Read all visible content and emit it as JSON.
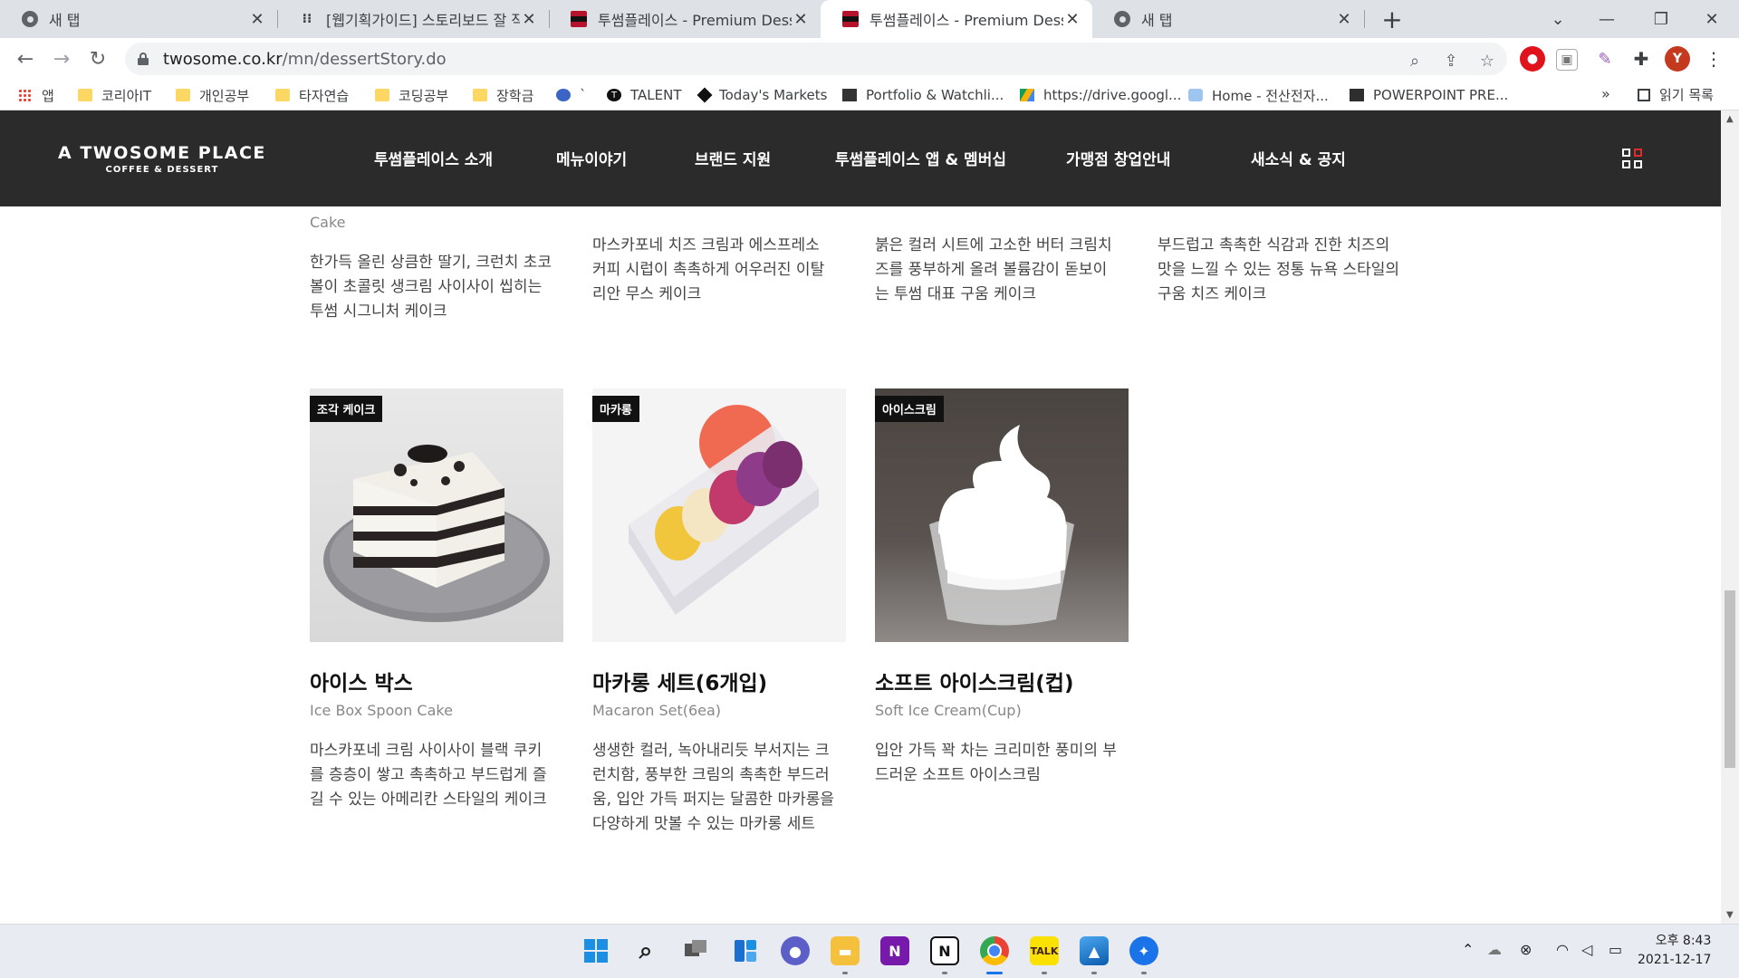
{
  "browser": {
    "tabs": [
      {
        "title": "새 탭",
        "icon": "chrome-icon",
        "active": false
      },
      {
        "title": "[웹기획가이드] 스토리보드 잘 작",
        "icon": "dots-icon",
        "active": false
      },
      {
        "title": "투썸플레이스 - Premium Desser",
        "icon": "twosome-icon",
        "active": false
      },
      {
        "title": "투썸플레이스 - Premium Desser",
        "icon": "twosome-icon",
        "active": true
      },
      {
        "title": "새 탭",
        "icon": "chrome-icon",
        "active": false
      }
    ],
    "new_tab": "+",
    "url_host": "twosome.co.kr",
    "url_path": "/mn/dessertStory.do",
    "profile_initial": "Y",
    "bookmarks": [
      {
        "label": "앱",
        "icon": "apps-grid-icon"
      },
      {
        "label": "코리아IT",
        "icon": "folder-icon"
      },
      {
        "label": "개인공부",
        "icon": "folder-icon"
      },
      {
        "label": "타자연습",
        "icon": "folder-icon"
      },
      {
        "label": "코딩공부",
        "icon": "folder-icon"
      },
      {
        "label": "장학금",
        "icon": "folder-icon"
      },
      {
        "label": "`",
        "icon": "globe-icon"
      },
      {
        "label": "TALENT",
        "icon": "talent-icon"
      },
      {
        "label": "Today's Markets",
        "icon": "markets-icon"
      },
      {
        "label": "Portfolio & Watchli...",
        "icon": "investing-icon"
      },
      {
        "label": "https://drive.googl...",
        "icon": "drive-icon"
      },
      {
        "label": "Home - 전산전자...",
        "icon": "home-site-icon"
      },
      {
        "label": "POWERPOINT PRE...",
        "icon": "hcc-icon"
      }
    ],
    "bookmarks_overflow": "»",
    "reading_list": "읽기 목록"
  },
  "site": {
    "logo_main": "A TWOSOME PLACE",
    "logo_sub": "COFFEE & DESSERT",
    "nav": [
      "투썸플레이스 소개",
      "메뉴이야기",
      "브랜드 지원",
      "투썸플레이스 앱 & 멤버십",
      "가맹점 창업안내",
      "새소식 & 공지"
    ]
  },
  "top_row": [
    {
      "name_en_tail": "Cake",
      "desc": [
        "한가득 올린 상큼한 딸기, 크런치 초코",
        "볼이 초콜릿 생크림 사이사이 씹히는",
        "투썸 시그니처 케이크"
      ]
    },
    {
      "desc": [
        "마스카포네 치즈 크림과 에스프레소",
        "커피 시럽이 촉촉하게 어우러진 이탈",
        "리안 무스 케이크"
      ]
    },
    {
      "desc": [
        "붉은 컬러 시트에 고소한 버터 크림치",
        "즈를 풍부하게 올려 볼륨감이 돋보이",
        "는 투썸 대표 구움 케이크"
      ]
    },
    {
      "desc": [
        "부드럽고 촉촉한 식감과 진한 치즈의",
        "맛을 느낄 수 있는 정통 뉴욕 스타일의",
        "구움 치즈 케이크"
      ]
    }
  ],
  "products": [
    {
      "badge": "조각 케이크",
      "name": "아이스 박스",
      "name_en": "Ice Box Spoon Cake",
      "desc": [
        "마스카포네 크림 사이사이 블랙 쿠키",
        "를 층층이 쌓고 촉촉하고 부드럽게 즐",
        "길 수 있는 아메리칸 스타일의 케이크"
      ]
    },
    {
      "badge": "마카롱",
      "name": "마카롱 세트(6개입)",
      "name_en": "Macaron Set(6ea)",
      "desc": [
        "생생한 컬러, 녹아내리듯 부서지는 크",
        "런치함, 풍부한 크림의 촉촉한 부드러",
        "움, 입안 가득 퍼지는 달콤한 마카롱을",
        "다양하게 맛볼 수 있는 마카롱 세트"
      ]
    },
    {
      "badge": "아이스크림",
      "name": "소프트 아이스크림(컵)",
      "name_en": "Soft Ice Cream(Cup)",
      "desc": [
        "입안 가득 꽉 차는 크리미한 풍미의 부",
        "드러운 소프트 아이스크림"
      ]
    }
  ],
  "taskbar": {
    "apps": [
      "windows-start-icon",
      "search-icon",
      "task-view-icon",
      "widgets-icon",
      "chat-icon",
      "file-explorer-icon",
      "onenote-icon",
      "notion-icon",
      "chrome-icon",
      "kakaotalk-icon",
      "photos-icon",
      "app-icon"
    ],
    "clock_time": "오후 8:43",
    "clock_date": "2021-12-17"
  },
  "colors": {
    "header_bg": "#2b2b2b",
    "accent_red": "#e02b2b",
    "badge_bg": "#111111"
  }
}
